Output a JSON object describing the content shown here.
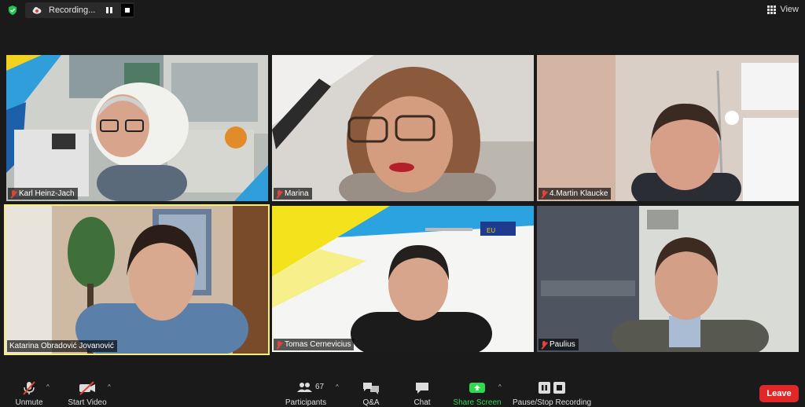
{
  "topbar": {
    "recording_label": "Recording...",
    "view_label": "View"
  },
  "participants": [
    {
      "name": "Karl Heinz-Jach",
      "muted": true
    },
    {
      "name": "Marina",
      "muted": true
    },
    {
      "name": "4.Martin Klaucke",
      "muted": true
    },
    {
      "name": "Katarina Obradović Jovanović",
      "muted": false,
      "active_speaker": true
    },
    {
      "name": "Tomas Cernevicius",
      "muted": true
    },
    {
      "name": "Paulius",
      "muted": true
    }
  ],
  "toolbar": {
    "unmute": "Unmute",
    "start_video": "Start Video",
    "participants_label": "Participants",
    "participants_count": "67",
    "qa": "Q&A",
    "chat": "Chat",
    "share_screen": "Share Screen",
    "pause_stop": "Pause/Stop Recording",
    "leave": "Leave"
  },
  "colors": {
    "share_green": "#2fd84c",
    "leave_red": "#e02828",
    "active_outline": "#f5f07a"
  }
}
